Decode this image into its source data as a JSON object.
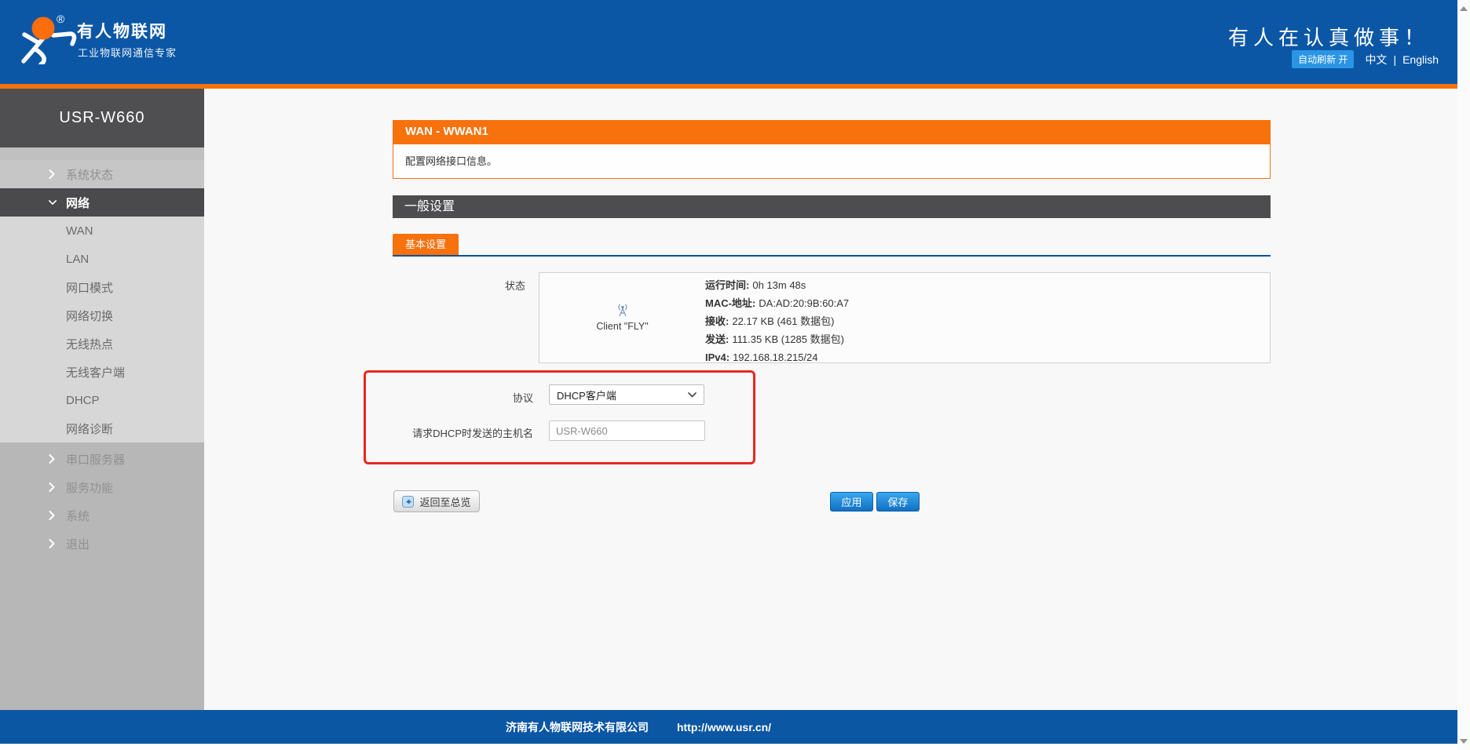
{
  "header": {
    "brand_title": "有人物联网",
    "brand_subtitle": "工业物联网通信专家",
    "registered_mark": "®",
    "slogan": "有人在认真做事！",
    "auto_refresh_badge": "自动刷新 开",
    "lang_zh": "中文",
    "lang_separator": "|",
    "lang_en": "English"
  },
  "sidebar": {
    "device_name": "USR-W660",
    "items": [
      {
        "label": "系统状态"
      },
      {
        "label": "网络"
      },
      {
        "label": "WAN"
      },
      {
        "label": "LAN"
      },
      {
        "label": "网口模式"
      },
      {
        "label": "网络切换"
      },
      {
        "label": "无线热点"
      },
      {
        "label": "无线客户端"
      },
      {
        "label": "DHCP"
      },
      {
        "label": "网络诊断"
      },
      {
        "label": "串口服务器"
      },
      {
        "label": "服务功能"
      },
      {
        "label": "系统"
      },
      {
        "label": "退出"
      }
    ]
  },
  "main": {
    "page_title": "WAN - WWAN1",
    "page_description": "配置网络接口信息。",
    "section_title": "一般设置",
    "tab_label": "基本设置",
    "status": {
      "label": "状态",
      "client_caption": "Client \"FLY\"",
      "icon": "wireless-signal-icon",
      "lines": [
        {
          "label": "运行时间:",
          "value": "0h 13m 48s"
        },
        {
          "label": "MAC-地址:",
          "value": "DA:AD:20:9B:60:A7"
        },
        {
          "label": "接收:",
          "value": "22.17 KB (461 数据包)"
        },
        {
          "label": "发送:",
          "value": "111.35 KB (1285 数据包)"
        },
        {
          "label": "IPv4:",
          "value": "192.168.18.215/24"
        }
      ]
    },
    "form": {
      "protocol_label": "协议",
      "protocol_value": "DHCP客户端",
      "hostname_label": "请求DHCP时发送的主机名",
      "hostname_value": "USR-W660"
    },
    "buttons": {
      "back": "返回至总览",
      "apply": "应用",
      "save": "保存"
    }
  },
  "footer": {
    "company": "济南有人物联网技术有限公司",
    "url": "http://www.usr.cn/"
  },
  "colors": {
    "header_blue": "#0b57a6",
    "orange": "#f7710c",
    "badge_blue": "#2a95e5",
    "annotation_red": "#e8281e",
    "dark_bar": "#4d4d4f",
    "button_blue": "#1170c2"
  }
}
